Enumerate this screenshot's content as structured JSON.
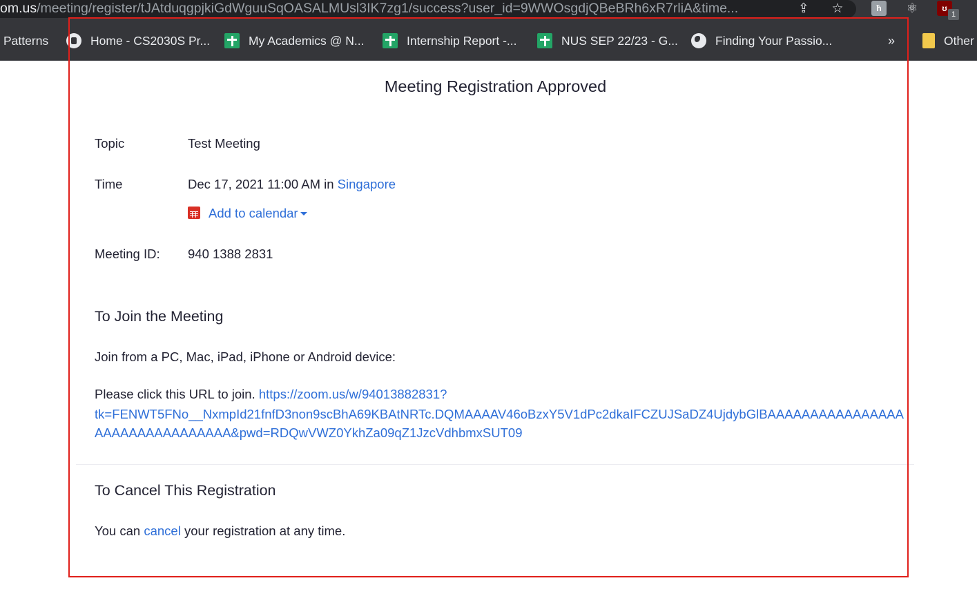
{
  "browser": {
    "url_host": "om.us",
    "url_path": "/meeting/register/tJAtduqgpjkiGdWguuSqOASALMUsl3IK7zg1/success?user_id=9WWOsgdjQBeBRh6xR7rliA&time...",
    "extension_badge_count": "1",
    "bookmarks": [
      {
        "label": "Patterns",
        "icon": "none"
      },
      {
        "label": "Home - CS2030S Pr...",
        "icon": "canvas-icon"
      },
      {
        "label": "My Academics @ N...",
        "icon": "sheets-icon"
      },
      {
        "label": "Internship Report -...",
        "icon": "sheets-icon"
      },
      {
        "label": "NUS SEP 22/23 - G...",
        "icon": "sheets-icon"
      },
      {
        "label": "Finding Your Passio...",
        "icon": "globe-icon"
      },
      {
        "label": "Other",
        "icon": "folder-icon"
      }
    ],
    "more_bookmarks": "»"
  },
  "page": {
    "title": "Meeting Registration Approved",
    "topic_label": "Topic",
    "topic_value": "Test Meeting",
    "time_label": "Time",
    "time_value": "Dec 17, 2021 11:00 AM in",
    "timezone_link": "Singapore",
    "add_to_calendar": "Add to calendar",
    "meeting_id_label": "Meeting ID:",
    "meeting_id_value": "940 1388 2831",
    "join_heading": "To Join the Meeting",
    "join_devices": "Join from a PC, Mac, iPad, iPhone or Android device:",
    "join_prompt": "Please click this URL to join.",
    "join_url": "https://zoom.us/w/94013882831?tk=FENWT5FNo__NxmpId21fnfD3non9scBhA69KBAtNRTc.DQMAAAAV46oBzxY5V1dPc2dkaIFCZUJSaDZ4UjdybGlBAAAAAAAAAAAAAAAAAAAAAAAAAAAAAAAA&pwd=RDQwVWZ0YkhZa09qZ1JzcVdhbmxSUT09",
    "cancel_heading": "To Cancel This Registration",
    "cancel_prefix": "You can",
    "cancel_link": "cancel",
    "cancel_suffix": "your registration at any time."
  },
  "colors": {
    "link": "#2f6fd8",
    "highlight_border": "#e0201b",
    "calendar_icon": "#d93025",
    "chrome_bg": "#35363a"
  }
}
